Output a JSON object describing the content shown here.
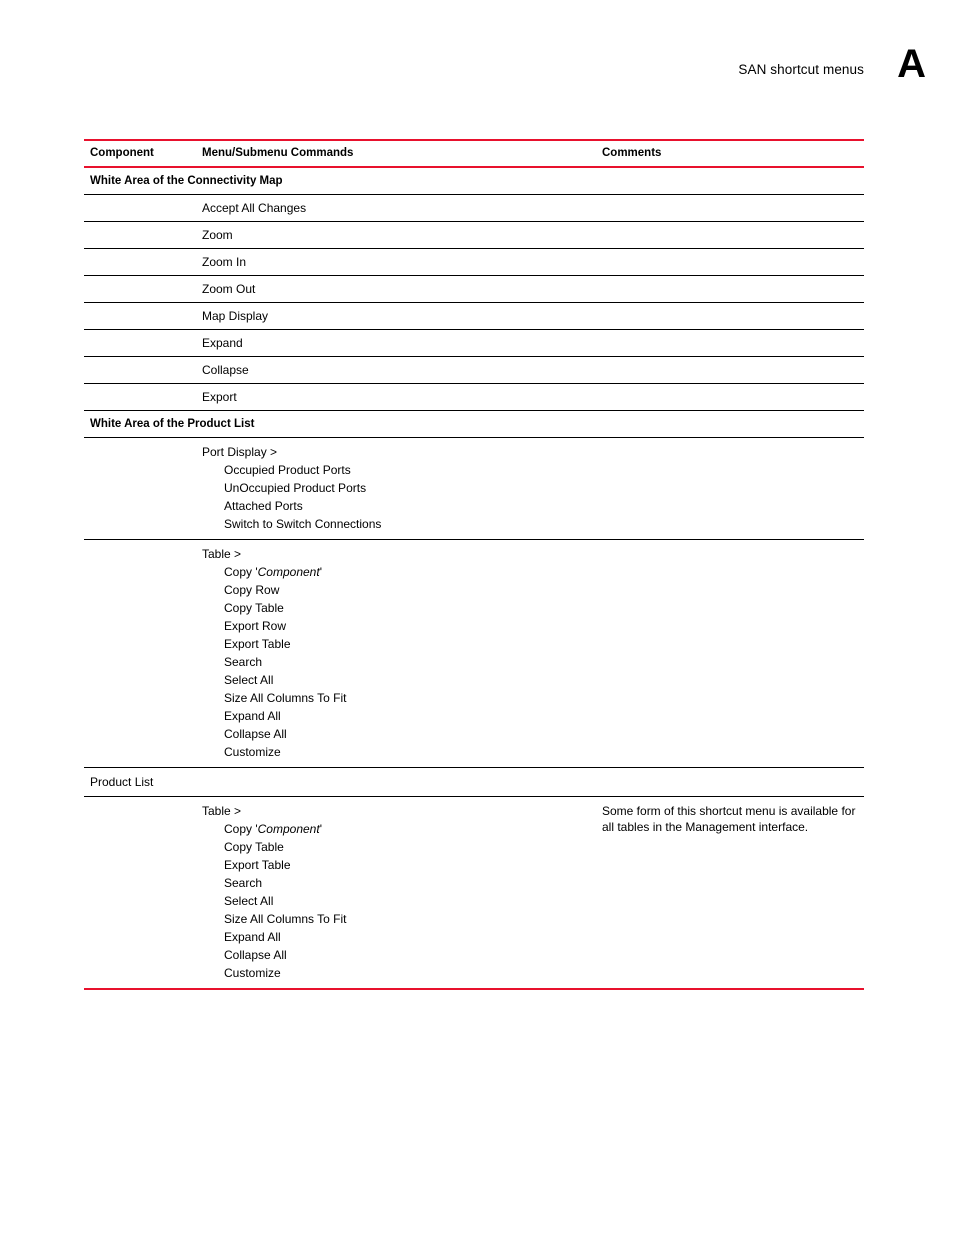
{
  "header": {
    "title": "SAN shortcut menus",
    "appendix_letter": "A"
  },
  "table": {
    "columns": {
      "component": "Component",
      "commands": "Menu/Submenu Commands",
      "comments": "Comments"
    },
    "sections": [
      {
        "title": "White Area of the Connectivity Map",
        "type": "section-header"
      }
    ],
    "rows": [
      {
        "command": "Accept All Changes"
      },
      {
        "command": "Zoom"
      },
      {
        "command": "Zoom In"
      },
      {
        "command": "Zoom Out"
      },
      {
        "command": "Map Display"
      },
      {
        "command": "Expand"
      },
      {
        "command": "Collapse"
      },
      {
        "command": "Export"
      }
    ],
    "section2": {
      "title": "White Area of the Product List"
    },
    "port_display": {
      "parent": "Port Display >",
      "items": [
        "Occupied Product Ports",
        "UnOccupied Product Ports",
        "Attached Ports",
        "Switch to Switch Connections"
      ]
    },
    "table_menu_1": {
      "parent": "Table >",
      "copy_prefix": "Copy '",
      "copy_italic": "Component",
      "copy_suffix": "'",
      "items": [
        "Copy Row",
        "Copy Table",
        "Export Row",
        "Export Table",
        "Search",
        "Select All",
        "Size All Columns To Fit",
        "Expand All",
        "Collapse All",
        "Customize"
      ]
    },
    "product_list": {
      "name": "Product List"
    },
    "table_menu_2": {
      "parent": "Table >",
      "copy_prefix": "Copy '",
      "copy_italic": "Component",
      "copy_suffix": "'",
      "items": [
        "Copy Table",
        "Export Table",
        "Search",
        "Select All",
        "Size All Columns To Fit",
        "Expand All",
        "Collapse All",
        "Customize"
      ],
      "comment": "Some form of this shortcut menu is available for all tables in the Management interface."
    }
  },
  "colors": {
    "rule_red": "#e8112d",
    "rule_black": "#000000",
    "text": "#000000"
  }
}
